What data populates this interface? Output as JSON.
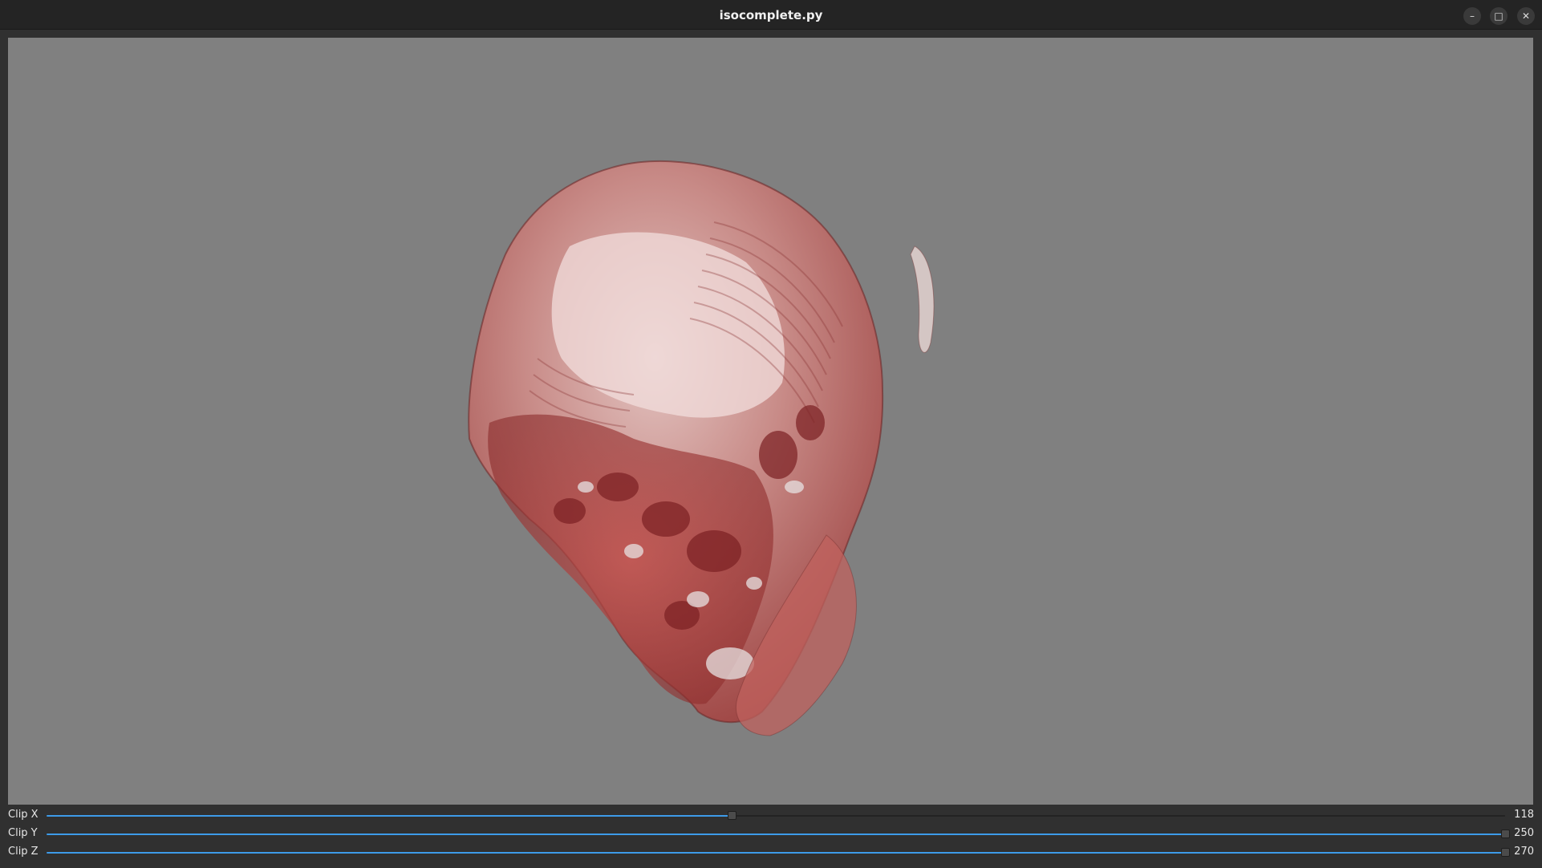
{
  "window": {
    "title": "isocomplete.py",
    "minimize_glyph": "–",
    "maximize_glyph": "□",
    "close_glyph": "✕"
  },
  "viewport": {
    "background": "#808080",
    "content": "volume-rendering-head-icon"
  },
  "sliders": [
    {
      "label": "Clip X",
      "value": "118",
      "fraction": 0.47,
      "accent": "#3d9be9"
    },
    {
      "label": "Clip Y",
      "value": "250",
      "fraction": 1.0,
      "accent": "#3d9be9"
    },
    {
      "label": "Clip Z",
      "value": "270",
      "fraction": 1.0,
      "accent": "#3d9be9"
    }
  ]
}
